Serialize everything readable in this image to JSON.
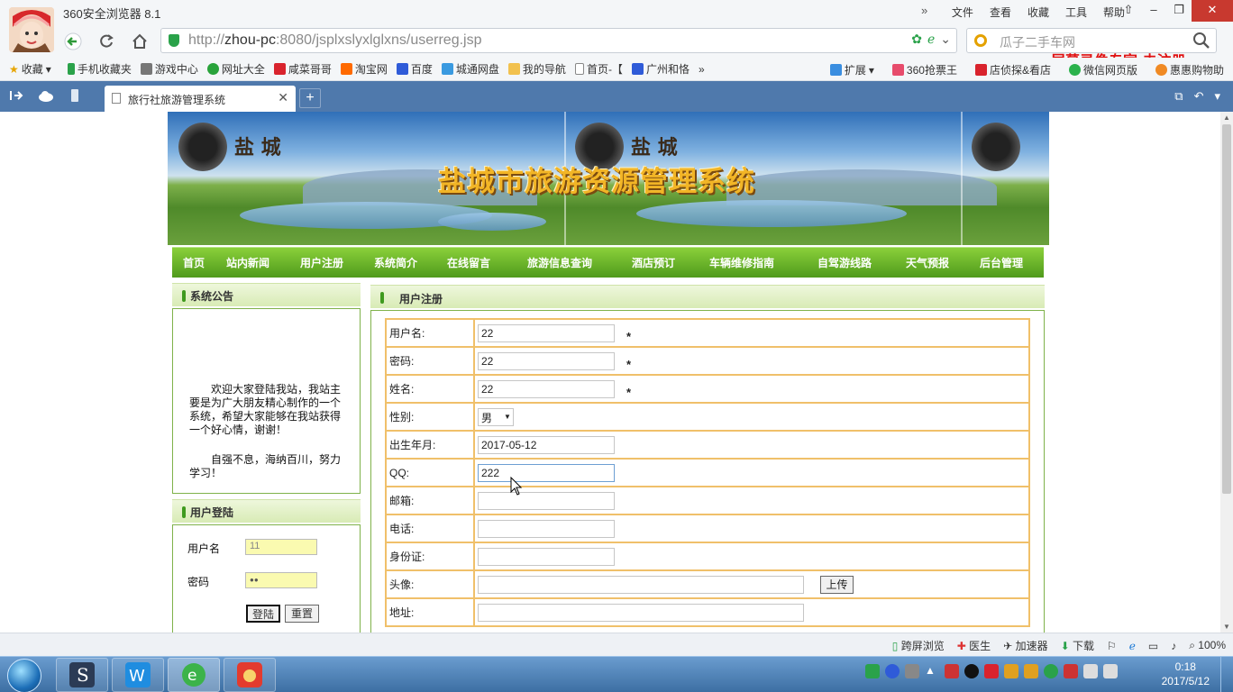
{
  "browser": {
    "app_title": "360安全浏览器 8.1",
    "menu": [
      "文件",
      "查看",
      "收藏",
      "工具",
      "帮助"
    ],
    "url_prefix": "http://",
    "url_host": "zhou-pc",
    "url_rest": ":8080/jsplxslyxlglxns/userreg.jsp",
    "search_placeholder": "瓜子二手车网",
    "watermark": "屏幕录像专家  未注册",
    "bookmarks": [
      "收藏",
      "手机收藏夹",
      "游戏中心",
      "网址大全",
      "咸菜哥哥",
      "淘宝网",
      "百度",
      "城通网盘",
      "我的导航",
      "首页-【",
      "广州和恪"
    ],
    "bookmarks_right": [
      "扩展",
      "360抢票王",
      "店侦探&看店",
      "微信网页版",
      "惠惠购物助"
    ],
    "tab_title": "旅行社旅游管理系统",
    "status_items": [
      "跨屏浏览",
      "医生",
      "加速器",
      "下载",
      "100%"
    ],
    "colors": {
      "tabbar": "#4f79ac",
      "nav_green": "#5aa424",
      "form_border": "#f0c06a"
    }
  },
  "site": {
    "banner_title": "盐城市旅游资源管理系统",
    "banner_logo": "盐 城",
    "nav": [
      "首页",
      "站内新闻",
      "用户注册",
      "系统简介",
      "在线留言",
      "旅游信息查询",
      "酒店预订",
      "车辆维修指南",
      "自驾游线路",
      "天气预报",
      "后台管理"
    ],
    "notice": {
      "title": "系统公告",
      "p1": "欢迎大家登陆我站，我站主要是为广大朋友精心制作的一个系统，希望大家能够在我站获得一个好心情，谢谢！",
      "p2": "自强不息，海纳百川，努力学习！"
    },
    "login": {
      "title": "用户登陆",
      "username_label": "用户名",
      "username_value": "11",
      "password_label": "密码",
      "password_value": "●●",
      "login_button": "登陆",
      "reset_button": "重置"
    },
    "register": {
      "title": "用户注册",
      "required_mark": "*",
      "upload_button": "上传",
      "fields": {
        "username": {
          "label": "用户名:",
          "value": "22"
        },
        "password": {
          "label": "密码:",
          "value": "22"
        },
        "name": {
          "label": "姓名:",
          "value": "22"
        },
        "gender": {
          "label": "性别:",
          "value": "男"
        },
        "birth": {
          "label": "出生年月:",
          "value": "2017-05-12"
        },
        "qq": {
          "label": "QQ:",
          "value": "222"
        },
        "email": {
          "label": "邮箱:",
          "value": ""
        },
        "phone": {
          "label": "电话:",
          "value": ""
        },
        "idcard": {
          "label": "身份证:",
          "value": ""
        },
        "avatar": {
          "label": "头像:",
          "value": ""
        },
        "address": {
          "label": "地址:",
          "value": ""
        }
      }
    }
  },
  "taskbar": {
    "time": "0:18",
    "date": "2017/5/12"
  }
}
